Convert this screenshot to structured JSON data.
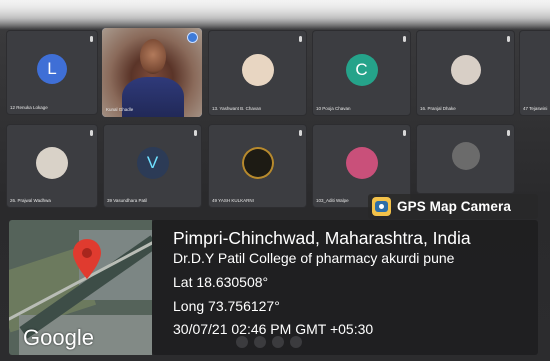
{
  "participants": [
    {
      "name": "12 Renuka Lokage",
      "initial": "L",
      "color": "#3f6fd6"
    },
    {
      "name": "Kunal Ghadle",
      "initial": "",
      "color": ""
    },
    {
      "name": "13. Yashwant B. Chavan",
      "initial": "",
      "color": "#e8d6c2"
    },
    {
      "name": "10 Pooja Chavan",
      "initial": "C",
      "color": "#25a38a"
    },
    {
      "name": "16. Pranjal Dhake",
      "initial": "",
      "color": "#d8cfc6"
    },
    {
      "name": "47 Tejaswini",
      "initial": "",
      "color": ""
    },
    {
      "name": "26. Prajwal Wadhwa",
      "initial": "",
      "color": "#d9d2c8"
    },
    {
      "name": "39 Vasundhara Patil",
      "initial": "V",
      "color": "#2c3b56"
    },
    {
      "name": "49 YASH KULKARNI",
      "initial": "",
      "color": "#1d1b14"
    },
    {
      "name": "103_Aditi Walpe",
      "initial": "",
      "color": "#c9507a"
    },
    {
      "name": "",
      "initial": "",
      "color": "#6b6b6b"
    }
  ],
  "gps": {
    "badge_label": "GPS Map Camera",
    "location": "Pimpri-Chinchwad, Maharashtra, India",
    "place": "Dr.D.Y Patil College of pharmacy akurdi pune",
    "lat": "Lat 18.630508°",
    "long": "Long 73.756127°",
    "datetime": "30/07/21 02:46 PM GMT +05:30",
    "map_brand": "Google"
  },
  "colors": {
    "pin_red": "#e03b2f",
    "overlay_bg": "#1c1c1e",
    "speaking_border": "#8bb8ff"
  }
}
